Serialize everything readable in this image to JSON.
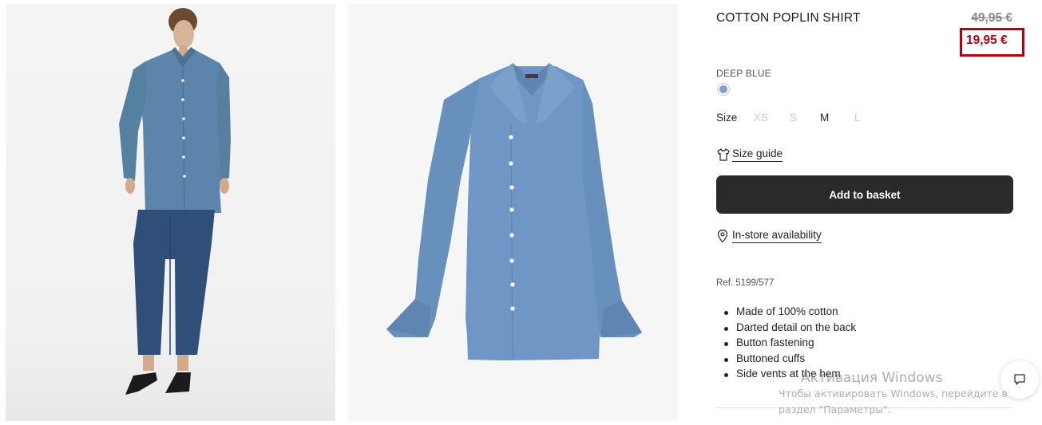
{
  "product": {
    "title": "COTTON POPLIN SHIRT",
    "old_price": "49,95 €",
    "new_price": "19,95 €",
    "color_name": "DEEP BLUE",
    "swatch_color": "#7f9fcb"
  },
  "sizes": {
    "label": "Size",
    "options": [
      {
        "label": "XS",
        "available": false
      },
      {
        "label": "S",
        "available": false
      },
      {
        "label": "M",
        "available": true
      },
      {
        "label": "L",
        "available": false
      }
    ]
  },
  "links": {
    "size_guide": "Size guide",
    "in_store": "In-store availability"
  },
  "actions": {
    "add_to_basket": "Add to basket"
  },
  "details": {
    "ref": "Ref. 5199/577",
    "features": [
      "Made of 100% cotton",
      "Darted detail on the back",
      "Button fastening",
      "Buttoned cuffs",
      "Side vents at the hem"
    ]
  },
  "watermark": {
    "title": "Активация Windows",
    "line1": "Чтобы активировать Windows, перейдите в",
    "line2": "раздел \"Параметры\"."
  },
  "colors": {
    "accent_red": "#b00014",
    "button_bg": "#2a2a2a",
    "shirt_blue": "#6f96c4"
  }
}
